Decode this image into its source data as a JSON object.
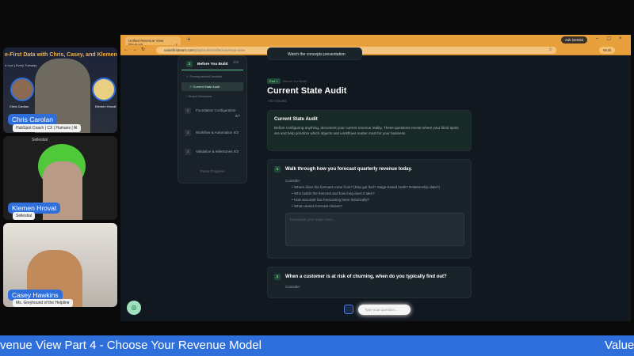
{
  "stream": {
    "show_title": "e-First Data with Chris, Casey, and Klemen",
    "show_subtitle": "n Live | Every Tuesday",
    "participants": [
      {
        "name": "Chris Carolan",
        "subtitle": "HubSpot Coach | CX | Humans | AI"
      },
      {
        "name": "Klemen Hrovat",
        "subtitle": "Sellestial",
        "logo_text": "Sellestial"
      },
      {
        "name": "Casey Hawkins",
        "subtitle": "Ms. Greyhound of the Helpline"
      }
    ],
    "thumb_names": [
      "Chris Carolan",
      "Klemen Hrovat"
    ],
    "ticker": "venue View Part 4 - Choose Your Revenue Model",
    "ticker_next": "Value"
  },
  "browser": {
    "tab_title": "Unified Revenue View Playbook",
    "url_domain": "valuefirstteam.com",
    "url_path": "/playbooks/unified-revenue-view",
    "ask_gemini": "Ask Gemini",
    "profile": "Work",
    "accent": "#e8a03c"
  },
  "sidebar": {
    "section": {
      "num": "1",
      "label": "Before You Build",
      "count": "2/3"
    },
    "items": [
      {
        "label": "Prerequisites/Checklist",
        "state": "done"
      },
      {
        "label": "Current State Audit",
        "state": "active"
      },
      {
        "label": "Scope Decisions",
        "state": "todo"
      }
    ],
    "groups": [
      {
        "num": "2",
        "label": "Foundation Configuration",
        "count": "0/7"
      },
      {
        "num": "3",
        "label": "Workflow & Automation",
        "count": "0/3"
      },
      {
        "num": "4",
        "label": "Validation & Milestones",
        "count": "0/3"
      }
    ],
    "reset": "Reset Progress"
  },
  "main": {
    "video_link": "Watch the concepts presentation",
    "part_badge": "Part 1",
    "breadcrumb": "Before You Build",
    "title": "Current State Audit",
    "duration": "~20 minutes",
    "intro_title": "Current State Audit",
    "intro_text": "Before configuring anything, document your current revenue reality. These questions reveal where your blind spots are and help prioritize which objects and workflows matter most for your business.",
    "questions": [
      {
        "num": "1",
        "text": "Walk through how you forecast quarterly revenue today.",
        "consider": "Consider:",
        "bullets": [
          "Where does the forecast come from? (Rep gut feel? Stage-based math? Relationship data?)",
          "Who builds the forecast and how long does it take?",
          "How accurate has forecasting been historically?",
          "What causes forecast misses?"
        ],
        "placeholder": "Document your notes here..."
      },
      {
        "num": "2",
        "text": "When a customer is at risk of churning, when do you typically find out?",
        "consider": "Consider:"
      }
    ],
    "chat_placeholder": "Type your question..."
  }
}
